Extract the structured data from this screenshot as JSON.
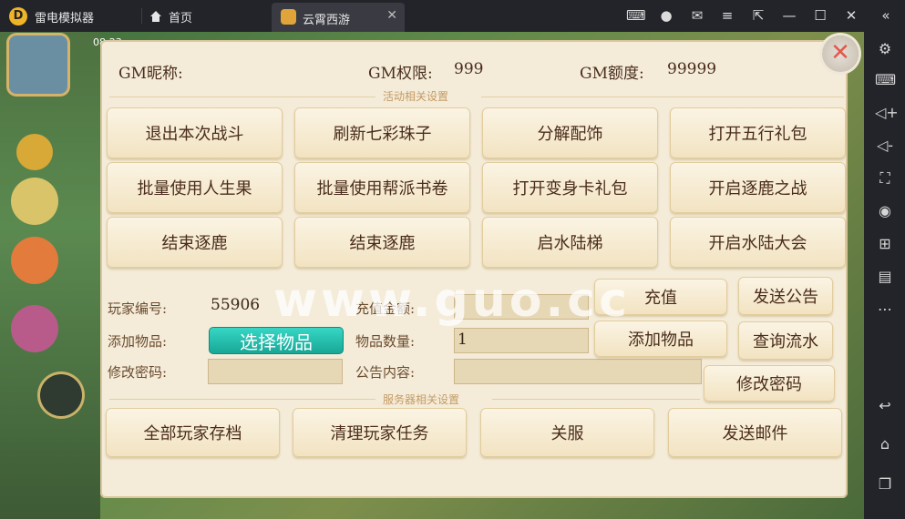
{
  "titlebar": {
    "app_name": "雷电模拟器",
    "home_tab": "首页",
    "game_tab": "云霄西游"
  },
  "status": {
    "time": "08:23"
  },
  "gm": {
    "nickname_label": "GM昵称:",
    "permission_label": "GM权限:",
    "permission_value": "999",
    "quota_label": "GM额度:",
    "quota_value": "99999"
  },
  "sections": {
    "activity": "活动相关设置",
    "server": "服务器相关设置"
  },
  "activity_buttons": [
    [
      "退出本次战斗",
      "刷新七彩珠子",
      "分解配饰",
      "打开五行礼包"
    ],
    [
      "批量使用人生果",
      "批量使用帮派书卷",
      "打开变身卡礼包",
      "开启逐鹿之战"
    ],
    [
      "结束逐鹿",
      "结束逐鹿",
      "启水陆梯",
      "开启水陆大会"
    ]
  ],
  "player": {
    "id_label": "玩家编号:",
    "id_value": "55906",
    "amount_label": "充值金额:",
    "amount_value": "",
    "add_item_label": "添加物品:",
    "pick_item_button": "选择物品",
    "qty_label": "物品数量:",
    "qty_value": "1",
    "password_label": "修改密码:",
    "password_value": "",
    "notice_label": "公告内容:",
    "notice_value": ""
  },
  "actions": {
    "recharge": "充值",
    "send_notice": "发送公告",
    "add_item": "添加物品",
    "query_flow": "查询流水",
    "change_password": "修改密码"
  },
  "server_buttons": [
    "全部玩家存档",
    "清理玩家任务",
    "关服",
    "发送邮件"
  ],
  "watermark": "www.guo.cc",
  "colors": {
    "panel": "#f4ecd9",
    "accent_teal": "#18a797",
    "close_red": "#e05a4e"
  }
}
